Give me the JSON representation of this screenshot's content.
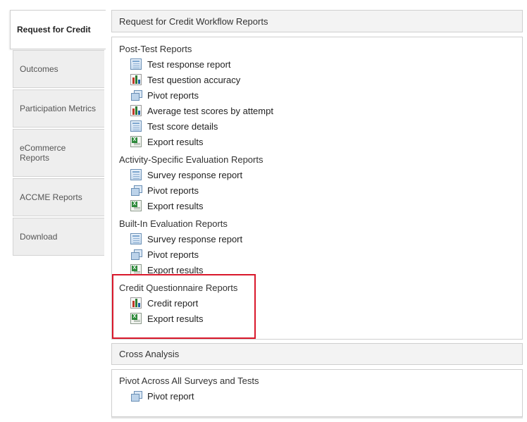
{
  "tabs": [
    {
      "label": "Request for Credit",
      "active": true
    },
    {
      "label": "Outcomes"
    },
    {
      "label": "Participation Metrics"
    },
    {
      "label": "eCommerce Reports"
    },
    {
      "label": "ACCME Reports"
    },
    {
      "label": "Download"
    }
  ],
  "workflow": {
    "header": "Request for Credit Workflow Reports",
    "sections": [
      {
        "title": "Post-Test Reports",
        "items": [
          {
            "label": "Test response report",
            "icon": "table-report-icon"
          },
          {
            "label": "Test question accuracy",
            "icon": "bar-chart-icon"
          },
          {
            "label": "Pivot reports",
            "icon": "pivot-icon"
          },
          {
            "label": "Average test scores by attempt",
            "icon": "bar-chart-icon"
          },
          {
            "label": "Test score details",
            "icon": "table-report-icon"
          },
          {
            "label": "Export results",
            "icon": "excel-export-icon"
          }
        ]
      },
      {
        "title": "Activity-Specific Evaluation Reports",
        "items": [
          {
            "label": "Survey response report",
            "icon": "table-report-icon"
          },
          {
            "label": "Pivot reports",
            "icon": "pivot-icon"
          },
          {
            "label": "Export results",
            "icon": "excel-export-icon"
          }
        ]
      },
      {
        "title": "Built-In Evaluation Reports",
        "items": [
          {
            "label": "Survey response report",
            "icon": "table-report-icon"
          },
          {
            "label": "Pivot reports",
            "icon": "pivot-icon"
          },
          {
            "label": "Export results",
            "icon": "excel-export-icon"
          }
        ]
      },
      {
        "title": "Credit Questionnaire Reports",
        "items": [
          {
            "label": "Credit report",
            "icon": "bar-chart-icon"
          },
          {
            "label": "Export results",
            "icon": "excel-export-icon"
          }
        ]
      }
    ]
  },
  "cross_analysis": {
    "header": "Cross Analysis"
  },
  "pivot_all": {
    "title": "Pivot Across All Surveys and Tests",
    "items": [
      {
        "label": "Pivot report",
        "icon": "pivot-icon"
      }
    ]
  },
  "colors": {
    "highlight": "#d9182b",
    "tab_bg": "#eeeeee",
    "header_bg": "#f3f3f3"
  }
}
